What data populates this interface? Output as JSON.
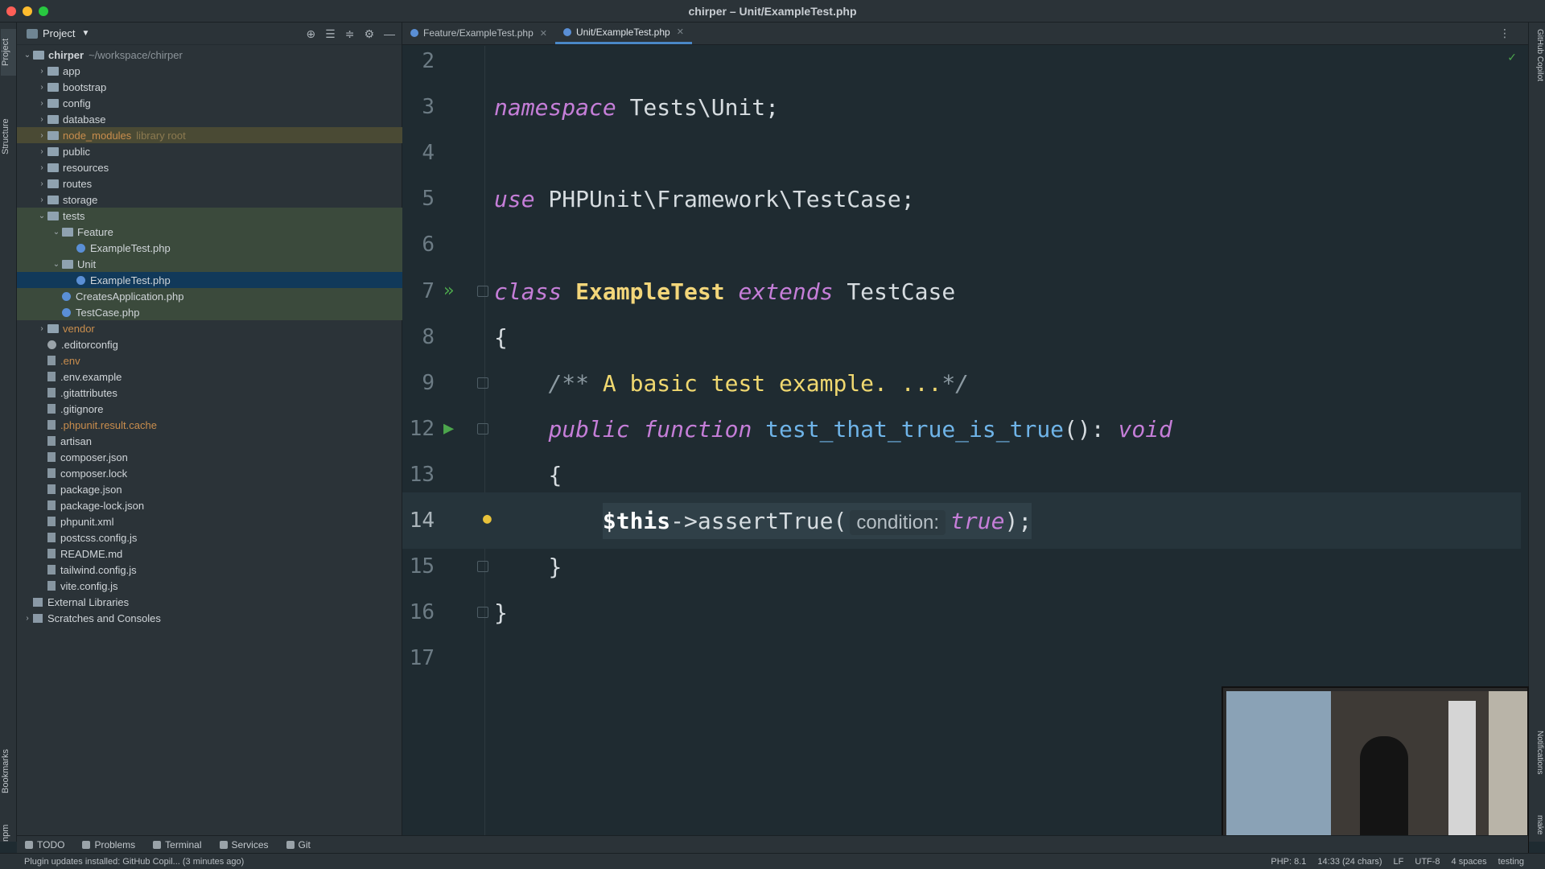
{
  "window": {
    "title": "chirper – Unit/ExampleTest.php"
  },
  "left_strip": {
    "project": "Project",
    "structure": "Structure",
    "bookmarks": "Bookmarks",
    "npm": "npm"
  },
  "right_strip": {
    "copilot": "GitHub Copilot",
    "notifications": "Notifications",
    "make": "make"
  },
  "project_panel": {
    "title": "Project",
    "tree": [
      {
        "label": "chirper",
        "extra": "~/workspace/chirper",
        "depth": 0,
        "type": "folder",
        "expanded": true
      },
      {
        "label": "app",
        "depth": 1,
        "type": "folder"
      },
      {
        "label": "bootstrap",
        "depth": 1,
        "type": "folder"
      },
      {
        "label": "config",
        "depth": 1,
        "type": "folder"
      },
      {
        "label": "database",
        "depth": 1,
        "type": "folder"
      },
      {
        "label": "node_modules",
        "extra": "library root",
        "depth": 1,
        "type": "folder",
        "style": "excluded"
      },
      {
        "label": "public",
        "depth": 1,
        "type": "folder"
      },
      {
        "label": "resources",
        "depth": 1,
        "type": "folder"
      },
      {
        "label": "routes",
        "depth": 1,
        "type": "folder"
      },
      {
        "label": "storage",
        "depth": 1,
        "type": "folder"
      },
      {
        "label": "tests",
        "depth": 1,
        "type": "folder",
        "expanded": true,
        "style": "testsrc"
      },
      {
        "label": "Feature",
        "depth": 2,
        "type": "folder",
        "expanded": true,
        "style": "testsrc"
      },
      {
        "label": "ExampleTest.php",
        "depth": 3,
        "type": "php",
        "style": "testsrc"
      },
      {
        "label": "Unit",
        "depth": 2,
        "type": "folder",
        "expanded": true,
        "style": "testsrc"
      },
      {
        "label": "ExampleTest.php",
        "depth": 3,
        "type": "php",
        "style": "selected"
      },
      {
        "label": "CreatesApplication.php",
        "depth": 2,
        "type": "php",
        "style": "testsrc"
      },
      {
        "label": "TestCase.php",
        "depth": 2,
        "type": "php",
        "style": "testsrc"
      },
      {
        "label": "vendor",
        "depth": 1,
        "type": "folder",
        "color": "orange"
      },
      {
        "label": ".editorconfig",
        "depth": 1,
        "type": "cfg"
      },
      {
        "label": ".env",
        "depth": 1,
        "type": "file",
        "color": "orange"
      },
      {
        "label": ".env.example",
        "depth": 1,
        "type": "file"
      },
      {
        "label": ".gitattributes",
        "depth": 1,
        "type": "file"
      },
      {
        "label": ".gitignore",
        "depth": 1,
        "type": "file"
      },
      {
        "label": ".phpunit.result.cache",
        "depth": 1,
        "type": "file",
        "color": "orange"
      },
      {
        "label": "artisan",
        "depth": 1,
        "type": "file"
      },
      {
        "label": "composer.json",
        "depth": 1,
        "type": "file"
      },
      {
        "label": "composer.lock",
        "depth": 1,
        "type": "file"
      },
      {
        "label": "package.json",
        "depth": 1,
        "type": "file"
      },
      {
        "label": "package-lock.json",
        "depth": 1,
        "type": "file"
      },
      {
        "label": "phpunit.xml",
        "depth": 1,
        "type": "file"
      },
      {
        "label": "postcss.config.js",
        "depth": 1,
        "type": "file"
      },
      {
        "label": "README.md",
        "depth": 1,
        "type": "file"
      },
      {
        "label": "tailwind.config.js",
        "depth": 1,
        "type": "file"
      },
      {
        "label": "vite.config.js",
        "depth": 1,
        "type": "file"
      },
      {
        "label": "External Libraries",
        "depth": 0,
        "type": "lib"
      },
      {
        "label": "Scratches and Consoles",
        "depth": 0,
        "type": "lib",
        "collapsed": true
      }
    ]
  },
  "editor_tabs": [
    {
      "label": "Feature/ExampleTest.php",
      "active": false
    },
    {
      "label": "Unit/ExampleTest.php",
      "active": true
    }
  ],
  "code": {
    "lines": [
      {
        "n": "2"
      },
      {
        "n": "3"
      },
      {
        "n": "4"
      },
      {
        "n": "5"
      },
      {
        "n": "6"
      },
      {
        "n": "7"
      },
      {
        "n": "8"
      },
      {
        "n": "9"
      },
      {
        "n": "12"
      },
      {
        "n": "13"
      },
      {
        "n": "14"
      },
      {
        "n": "15"
      },
      {
        "n": "16"
      },
      {
        "n": "17"
      }
    ],
    "namespace_kw": "namespace",
    "namespace_val": " Tests\\Unit;",
    "use_kw": "use",
    "use_val": " PHPUnit\\Framework\\TestCase;",
    "class_kw": "class",
    "class_name": "ExampleTest",
    "extends_kw": "extends",
    "parent": "TestCase",
    "open_brace": "{",
    "close_brace": "}",
    "doc_open": "/**",
    "doc_text": " A basic test example. ...",
    "doc_close": "*/",
    "public_kw": "public",
    "function_kw": "function",
    "method_name": "test_that_true_is_true",
    "method_sig": "(): ",
    "void_kw": "void",
    "this_var": "$this",
    "call": "->assertTrue(",
    "param_hint": "condition:",
    "arg": "true",
    "call_end": ");"
  },
  "bottom_tools": [
    "TODO",
    "Problems",
    "Terminal",
    "Services",
    "Git"
  ],
  "status": {
    "message": "Plugin updates installed: GitHub Copil... (3 minutes ago)",
    "items": [
      "PHP: 8.1",
      "14:33 (24 chars)",
      "LF",
      "UTF-8",
      "4 spaces",
      "testing"
    ]
  },
  "colors": {
    "accent": "#4a88c7",
    "selected_row": "#11395a",
    "test_row": "#3b4a3c"
  }
}
